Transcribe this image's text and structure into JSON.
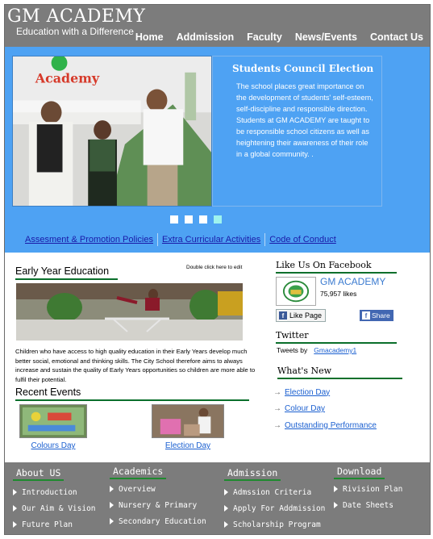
{
  "header": {
    "brand": "GM ACADEMY",
    "tagline": "Education with a Difference",
    "nav": [
      "Home",
      "Addmission",
      "Faculty",
      "News/Events",
      "Contact Us"
    ]
  },
  "hero": {
    "photo_text": "Academy",
    "title": "Students Council Election",
    "text": "The school places great importance on the development of students' self-esteem, self-discipline and responsible direction. Students at GM ACADEMY are taught to be responsible school citizens as well as heightening their awareness of their role in a global community. .",
    "slides": 4,
    "active_slide": 4,
    "quick_links": [
      "Assesment & Promotion Policies",
      "Extra Curricular Activities",
      "Code of Conduct"
    ]
  },
  "early": {
    "heading": "Early Year Education",
    "note": "Double click here to edit",
    "text": "Children who have access to high quality education in their Early Years develop much better social, emotional and thinking skills. The City School therefore aims to always increase and sustain the quality of Early Years opportunities so children are more able to fulfil their potential."
  },
  "recent": {
    "heading": "Recent Events",
    "events": [
      "Colours Day",
      "Election Day"
    ]
  },
  "facebook": {
    "heading": "Like Us On Facebook",
    "name": "GM ACADEMY",
    "likes": "75,957 likes",
    "like_button": "Like Page",
    "share_button": "Share"
  },
  "twitter": {
    "heading": "Twitter",
    "tweets_by": "Tweets by",
    "handle": "Gmacademy1"
  },
  "whats_new": {
    "heading": "What's New",
    "items": [
      "Election Day",
      "Colour Day",
      "Outstanding Performance"
    ]
  },
  "footer": {
    "columns": [
      {
        "heading": "About US",
        "items": [
          "Introduction",
          "Our Aim & Vision",
          "Future Plan"
        ]
      },
      {
        "heading": "Academics",
        "items": [
          "Overview",
          "Nursery & Primary",
          "Secondary Education"
        ]
      },
      {
        "heading": "Admission",
        "items": [
          "Admssion Criteria",
          "Apply For Addmission",
          "Scholarship Program"
        ]
      },
      {
        "heading": "Download",
        "items": [
          "Rivision Plan",
          "Date Sheets"
        ]
      }
    ]
  },
  "colors": {
    "header_bg": "#7c7c7c",
    "hero_bg": "#4ea2f3",
    "accent_green": "#0a6f2b",
    "link_blue": "#1a5fd0"
  }
}
